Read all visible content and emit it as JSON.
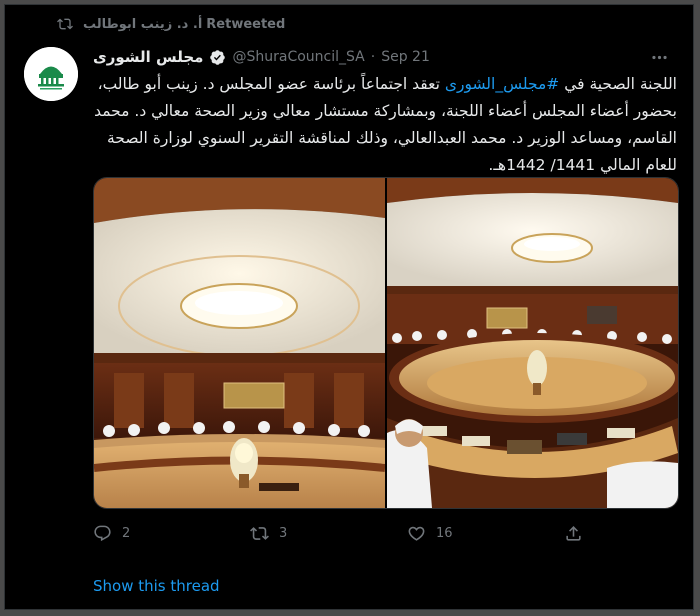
{
  "retweet": {
    "by": "أ. د. زينب ابوطالب",
    "label": "Retweeted"
  },
  "author": {
    "name": "مجلس الشورى",
    "handle": "@ShuraCouncil_SA",
    "separator": "·",
    "date": "Sep 21",
    "verified": true
  },
  "tweet": {
    "hashtag": "#مجلس_الشورى",
    "text_before": "اللجنة الصحية في ",
    "text_after": " تعقد اجتماعاً برئاسة عضو المجلس د. زينب أبو طالب، بحضور أعضاء المجلس أعضاء اللجنة، وبمشاركة مستشار معالي وزير الصحة معالي د. محمد القاسم، ومساعد الوزير د. محمد العبدالعالي، وذلك لمناقشة التقرير السنوي لوزارة الصحة للعام المالي 1441/ 1442هـ."
  },
  "media": {
    "photos": [
      {
        "subject": "council meeting room with chandelier"
      },
      {
        "subject": "council meeting room oval table"
      }
    ]
  },
  "actions": {
    "reply": {
      "count": "2",
      "icon": "reply-icon"
    },
    "retweet": {
      "count": "3",
      "icon": "retweet-icon"
    },
    "like": {
      "count": "16",
      "icon": "heart-icon"
    },
    "share": {
      "icon": "share-icon"
    }
  },
  "show_thread": "Show this thread",
  "colors": {
    "background": "#000000",
    "accent": "#1d9bf0",
    "muted": "#71767b",
    "text": "#e7e9ea"
  }
}
